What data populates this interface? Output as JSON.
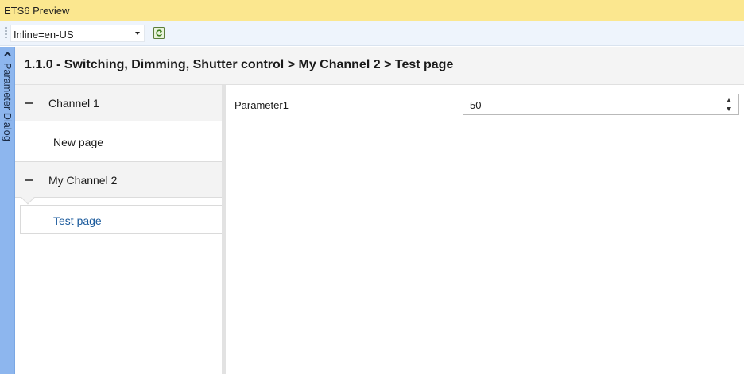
{
  "window": {
    "title": "ETS6 Preview"
  },
  "toolbar": {
    "language_value": "Inline=en-US",
    "refresh_icon": "refresh-icon"
  },
  "sidebar_tab": {
    "label": "Parameter Dialog",
    "icon": "chevron-up-icon"
  },
  "header": {
    "breadcrumb": "1.1.0 - Switching, Dimming, Shutter control > My Channel 2 > Test page"
  },
  "nav": {
    "groups": [
      {
        "label": "Channel 1",
        "pages": [
          {
            "label": "New page",
            "selected": false
          }
        ]
      },
      {
        "label": "My Channel 2",
        "pages": [
          {
            "label": "Test page",
            "selected": true
          }
        ]
      }
    ]
  },
  "content": {
    "parameters": [
      {
        "label": "Parameter1",
        "value": "50"
      }
    ]
  },
  "colors": {
    "titlebar": "#fbe78f",
    "sidetab": "#8db6ee",
    "selected_text": "#1a5a9c"
  }
}
